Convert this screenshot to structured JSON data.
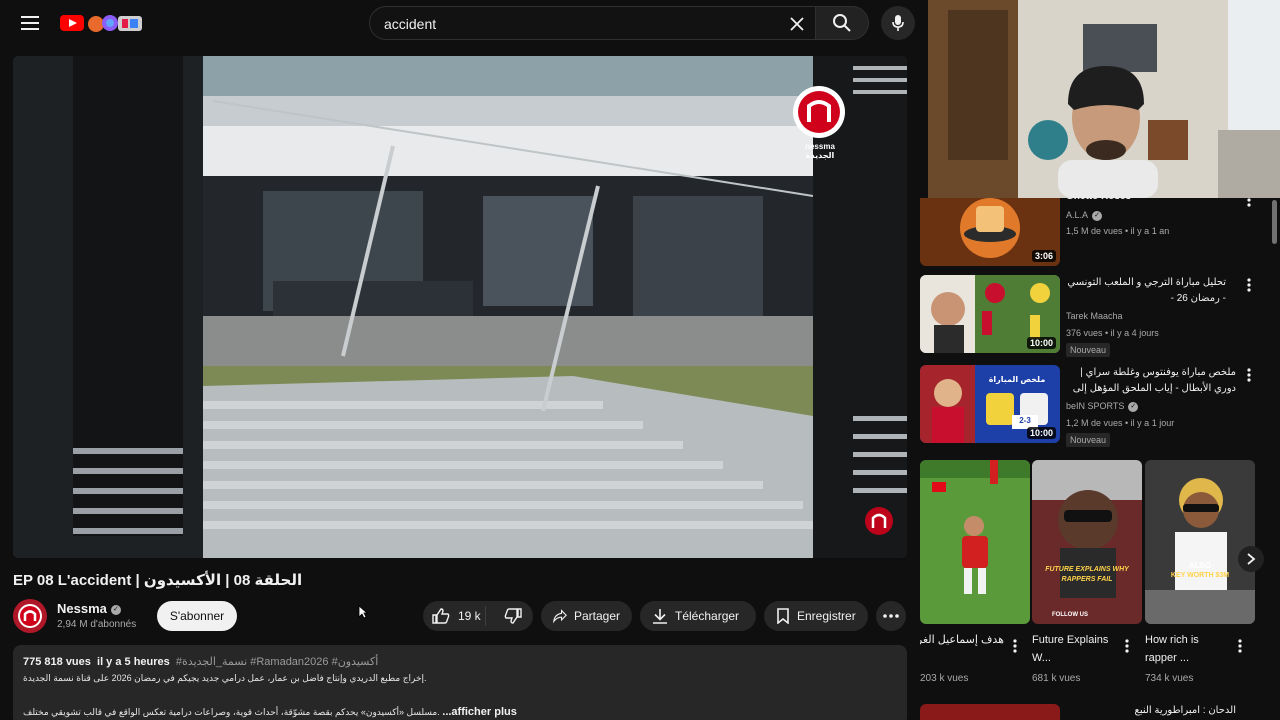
{
  "search": {
    "query": "accident"
  },
  "video": {
    "title": "EP 08 L'accident | الحلقة 08 | الأكسيدون",
    "channel": "Nessma",
    "subscribers": "2,94 M d'abonnés",
    "subscribe_label": "S'abonner",
    "likes": "19 k",
    "share_label": "Partager",
    "download_label": "Télécharger",
    "save_label": "Enregistrer",
    "player_logo_text": "nessma الجديدة"
  },
  "description": {
    "views": "775 818 vues",
    "age": "il y a 5 heures",
    "tags": "#نسمة_الجديدة #Ramadan2026 #أكسيدون",
    "line1": "إخراج مطبع الدريدي وإنتاج فاضل بن عمار، عمل درامي جديد يجيكم في رمضان 2026 على قناة نسمة الجديدة.",
    "line2": "مسلسل «أكسيدون» يحدكم بقصة مشوّقة، أحداث قوية، وصراعات درامية تعكس الواقع في قالب تشويقي مختلف.",
    "more": "...afficher plus"
  },
  "sidebar": [
    {
      "title": "Ghetto Roses",
      "channel": "A.L.A",
      "meta": "1,5 M de vues • il y a 1 an",
      "duration": "3:06",
      "badge": ""
    },
    {
      "title": "تحليل مباراة الترجي و الملعب التونسي - رمضان 26 -",
      "channel": "Tarek Maacha",
      "meta": "376 vues • il y a 4 jours",
      "duration": "10:00",
      "badge": "Nouveau"
    },
    {
      "title": "ملخص مباراة يوفنتوس وغلطة سراي | دوري الأبطال - إياب الملحق المؤهل إلى ثمن ...",
      "channel": "beIN SPORTS",
      "meta": "1,2 M de vues • il y a 1 jour",
      "duration": "10:00",
      "badge": "Nouveau"
    }
  ],
  "shorts": [
    {
      "title": "هدف إسماعيل الغربي مع براغا ...",
      "views": "203 k vues"
    },
    {
      "title": "Future Explains W...",
      "views": "681 k vues",
      "overlay": "FUTURE EXPLAINS WHY RAPPERS FAIL",
      "overlay2": "FOLLOW US"
    },
    {
      "title": "How rich is rapper ...",
      "views": "734 k vues",
      "overlay": "ALSO",
      "overlay2": "KEY WORTH $3M"
    }
  ],
  "next_item_title": "الدحان : امبراطورية النبع",
  "thumb_text": {
    "bein": "ملخص المباراة",
    "bein_score": "2-3"
  }
}
